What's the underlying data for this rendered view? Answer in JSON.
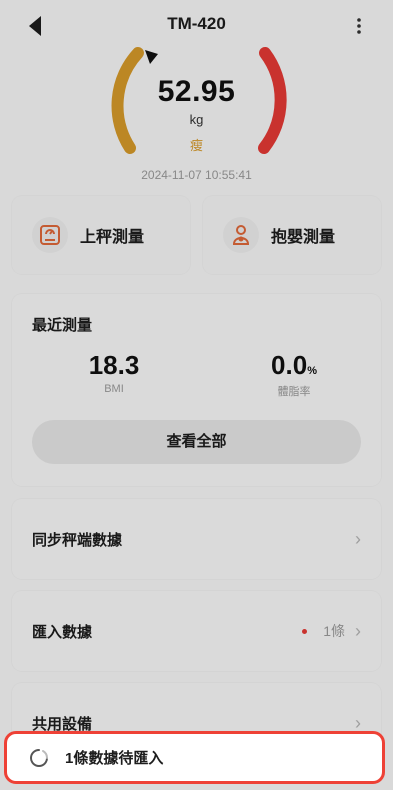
{
  "header": {
    "title": "TM-420",
    "more_icon": "more-vertical-icon",
    "back_icon": "back-arrow-icon"
  },
  "gauge": {
    "weight": "52.95",
    "unit": "kg",
    "status": "瘦",
    "timestamp": "2024-11-07 10:55:41",
    "colors": {
      "left_arc": "#d79a2a",
      "right_arc": "#e53935",
      "status": "#d79a2a"
    }
  },
  "actions": [
    {
      "label": "上秤測量",
      "icon": "scale-icon"
    },
    {
      "label": "抱嬰測量",
      "icon": "baby-icon"
    }
  ],
  "recent": {
    "title": "最近測量",
    "bmi": {
      "value": "18.3",
      "caption": "BMI"
    },
    "body_fat": {
      "value": "0.0",
      "unit": "%",
      "caption": "體脂率"
    },
    "view_all": "查看全部"
  },
  "rows": [
    {
      "label": "同步秤端數據"
    },
    {
      "label": "匯入數據",
      "count": "1條"
    },
    {
      "label": "共用設備"
    }
  ],
  "toast": {
    "text": "1條數據待匯入",
    "border_color": "#ee4136"
  }
}
